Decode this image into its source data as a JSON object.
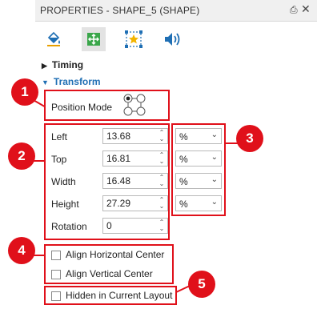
{
  "header": {
    "title": "PROPERTIES - SHAPE_5 (SHAPE)",
    "pin_icon": "pin-icon",
    "close_icon": "close-icon"
  },
  "tabs": [
    {
      "icon": "paint-bucket-icon",
      "active": false
    },
    {
      "icon": "transform-icon",
      "active": true
    },
    {
      "icon": "star-selection-icon",
      "active": false
    },
    {
      "icon": "sound-icon",
      "active": false
    }
  ],
  "sections": {
    "timing": "Timing",
    "transform": "Transform"
  },
  "position_mode": {
    "label": "Position Mode"
  },
  "fields": [
    {
      "label": "Left",
      "value": "13.68",
      "unit": "%"
    },
    {
      "label": "Top",
      "value": "16.81",
      "unit": "%"
    },
    {
      "label": "Width",
      "value": "16.48",
      "unit": "%"
    },
    {
      "label": "Height",
      "value": "27.29",
      "unit": "%"
    }
  ],
  "rotation": {
    "label": "Rotation",
    "value": "0"
  },
  "checkboxes": {
    "align_horizontal": "Align Horizontal Center",
    "align_vertical": "Align Vertical Center",
    "hidden_layout": "Hidden in Current Layout"
  },
  "callouts": [
    "1",
    "2",
    "3",
    "4",
    "5"
  ],
  "colors": {
    "accent_blue": "#1f6fb4",
    "callout_red": "#e0101a",
    "active_tab_green": "#3aa64a"
  }
}
